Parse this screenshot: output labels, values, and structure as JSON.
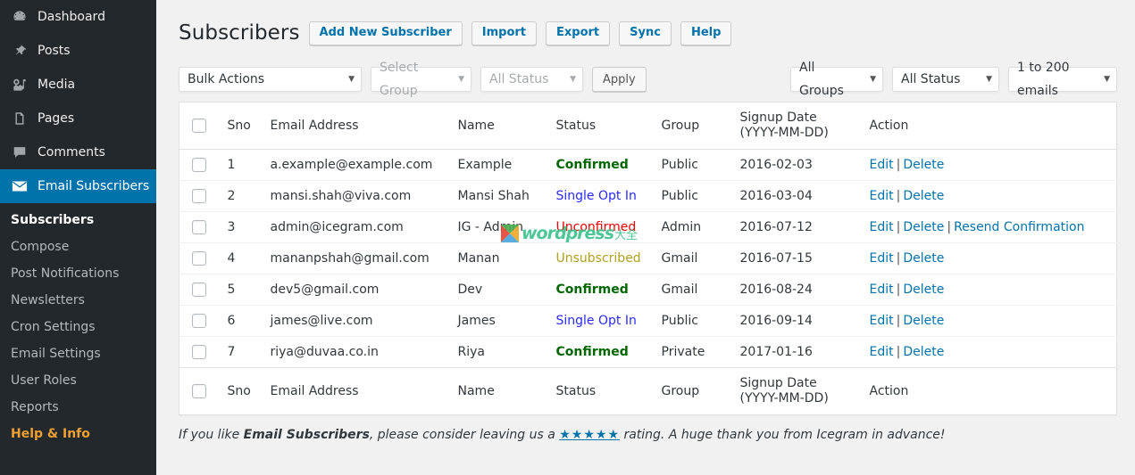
{
  "sidebar": {
    "top_items": [
      {
        "label": "Dashboard",
        "icon": "dashboard-icon",
        "current": false
      },
      {
        "label": "Posts",
        "icon": "pin-icon",
        "current": false
      },
      {
        "label": "Media",
        "icon": "media-icon",
        "current": false
      },
      {
        "label": "Pages",
        "icon": "pages-icon",
        "current": false
      },
      {
        "label": "Comments",
        "icon": "comment-icon",
        "current": false
      },
      {
        "label": "Email Subscribers",
        "icon": "envelope-icon",
        "current": true
      }
    ],
    "sub_items": [
      {
        "label": "Subscribers",
        "state": "current"
      },
      {
        "label": "Compose",
        "state": ""
      },
      {
        "label": "Post Notifications",
        "state": ""
      },
      {
        "label": "Newsletters",
        "state": ""
      },
      {
        "label": "Cron Settings",
        "state": ""
      },
      {
        "label": "Email Settings",
        "state": ""
      },
      {
        "label": "User Roles",
        "state": ""
      },
      {
        "label": "Reports",
        "state": ""
      },
      {
        "label": "Help & Info",
        "state": "help"
      }
    ]
  },
  "header": {
    "title": "Subscribers",
    "buttons": [
      {
        "label": "Add New Subscriber"
      },
      {
        "label": "Import"
      },
      {
        "label": "Export"
      },
      {
        "label": "Sync"
      },
      {
        "label": "Help"
      }
    ]
  },
  "toolbar": {
    "bulk_actions": "Bulk Actions",
    "select_group": "Select Group",
    "all_status": "All Status",
    "apply_label": "Apply",
    "all_groups_right": "All Groups",
    "all_status_right": "All Status",
    "emails_range": "1 to 200 emails",
    "caret": "▼"
  },
  "table": {
    "columns": {
      "sno": "Sno",
      "email": "Email Address",
      "name": "Name",
      "status": "Status",
      "group": "Group",
      "date_line1": "Signup Date",
      "date_line2": "(YYYY-MM-DD)",
      "action": "Action"
    },
    "action_labels": {
      "edit": "Edit",
      "delete": "Delete",
      "resend": "Resend Confirmation",
      "separator": "|"
    },
    "rows": [
      {
        "sno": "1",
        "email": "a.example@example.com",
        "name": "Example",
        "status": "Confirmed",
        "status_class": "st-confirmed",
        "group": "Public",
        "date": "2016-02-03",
        "resend": false
      },
      {
        "sno": "2",
        "email": "mansi.shah@viva.com",
        "name": "Mansi Shah",
        "status": "Single Opt In",
        "status_class": "st-singleoptin",
        "group": "Public",
        "date": "2016-03-04",
        "resend": false
      },
      {
        "sno": "3",
        "email": "admin@icegram.com",
        "name": "IG - Admin",
        "status": "Unconfirmed",
        "status_class": "st-unconfirmed",
        "group": "Admin",
        "date": "2016-07-12",
        "resend": true
      },
      {
        "sno": "4",
        "email": "mananpshah@gmail.com",
        "name": "Manan",
        "status": "Unsubscribed",
        "status_class": "st-unsub",
        "group": "Gmail",
        "date": "2016-07-15",
        "resend": false
      },
      {
        "sno": "5",
        "email": "dev5@gmail.com",
        "name": "Dev",
        "status": "Confirmed",
        "status_class": "st-confirmed",
        "group": "Gmail",
        "date": "2016-08-24",
        "resend": false
      },
      {
        "sno": "6",
        "email": "james@live.com",
        "name": "James",
        "status": "Single Opt In",
        "status_class": "st-singleoptin",
        "group": "Public",
        "date": "2016-09-14",
        "resend": false
      },
      {
        "sno": "7",
        "email": "riya@duvaa.co.in",
        "name": "Riya",
        "status": "Confirmed",
        "status_class": "st-confirmed",
        "group": "Private",
        "date": "2017-01-16",
        "resend": false
      }
    ]
  },
  "footer_note": {
    "part1": "If you like ",
    "bold": "Email Subscribers",
    "part2": ", please consider leaving us a ",
    "stars": "★★★★★",
    "part3": " rating. A huge thank you from Icegram in advance!"
  },
  "watermark": {
    "text": "wordpress",
    "suffix": "大全",
    "color": "#3ec28f"
  },
  "colors": {
    "accent_blue": "#0073aa",
    "sidebar_bg": "#23282d",
    "page_bg": "#f1f1f1",
    "confirmed": "#006600",
    "single_opt_in": "#2a2aff",
    "unconfirmed": "#ee0000",
    "unsubscribed": "#b0a020",
    "help_orange": "#f0a030"
  }
}
